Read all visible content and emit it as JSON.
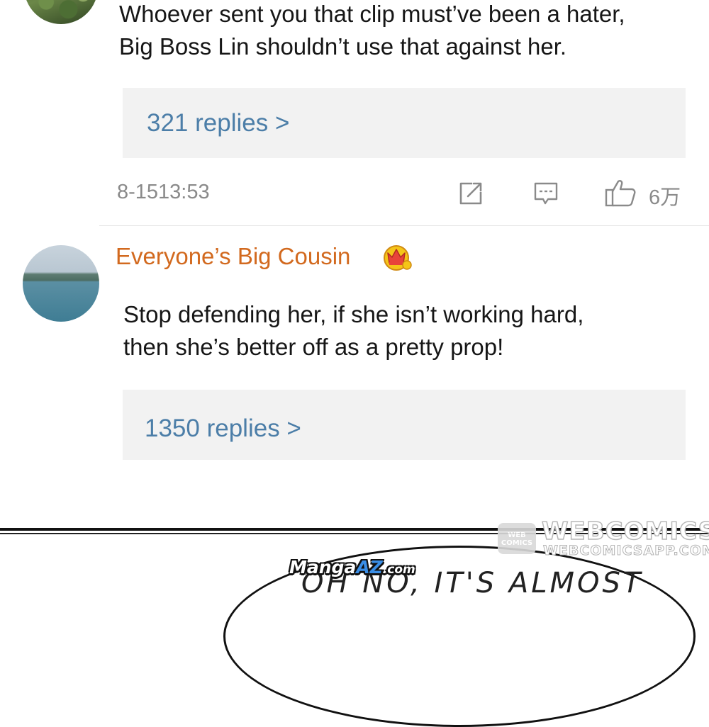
{
  "comments": [
    {
      "text_lines": [
        "Whoever sent you that clip must’ve been a hater,",
        "Big Boss Lin shouldn’t use that against her."
      ],
      "replies_label": "321 replies >",
      "timestamp": "8-1513:53",
      "like_count": "6万"
    },
    {
      "username": "Everyone’s Big Cousin",
      "text_lines": [
        "Stop defending her, if she isn’t working hard,",
        "then she’s better off as a pretty prop!"
      ],
      "replies_label": "1350 replies >"
    }
  ],
  "icons": {
    "share": "share-icon",
    "comment": "comment-icon",
    "like": "thumbs-up-icon",
    "badge": "crown-icon"
  },
  "colors": {
    "username": "#d2691e",
    "reply_link": "#4c7ea8",
    "reply_box": "#f2f2f2",
    "meta_text": "#8a8a8a"
  },
  "comic": {
    "bubble_text": "OH NO, IT'S ALMOST"
  },
  "watermarks": {
    "logo_text_line1": "WEB",
    "logo_text_line2": "COMICS",
    "title": "WEBCOMICS",
    "subtitle": "WEBCOMICSAPP.COM",
    "mangaaz_prefix": "Manga",
    "mangaaz_az": "AZ",
    "mangaaz_suffix": ".com"
  }
}
